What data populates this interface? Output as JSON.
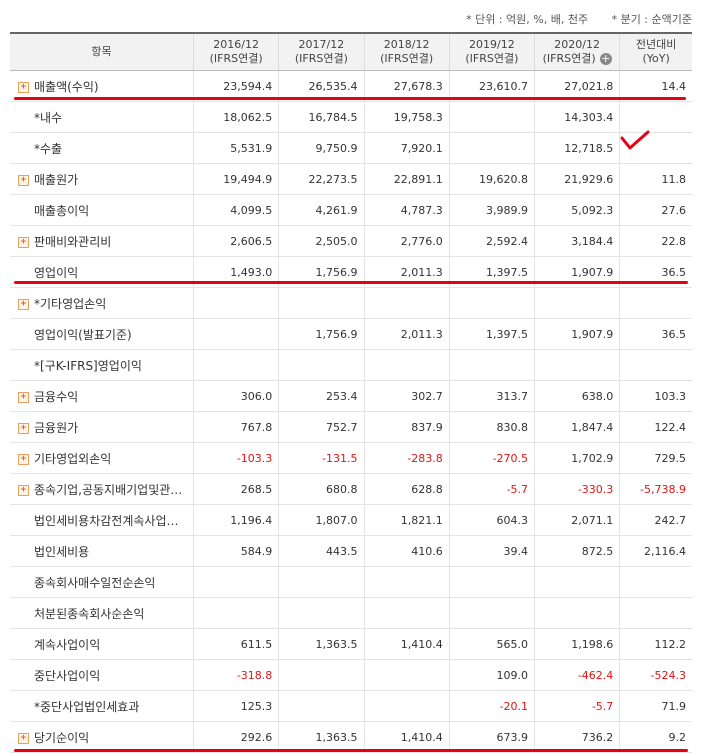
{
  "notes": {
    "unit": "* 단위 : 억원, %, 배, 천주",
    "basis": "* 분기 : 순액기준"
  },
  "columns": [
    "항목",
    "2016/12\n(IFRS연결)",
    "2017/12\n(IFRS연결)",
    "2018/12\n(IFRS연결)",
    "2019/12\n(IFRS연결)",
    "2020/12\n(IFRS연결)",
    "전년대비\n(YoY)"
  ],
  "rows": [
    {
      "label": "매출액(수익)",
      "expand": true,
      "indent": false,
      "values": [
        "23,594.4",
        "26,535.4",
        "27,678.3",
        "23,610.7",
        "27,021.8",
        "14.4"
      ],
      "neg": []
    },
    {
      "label": "*내수",
      "expand": false,
      "indent": true,
      "values": [
        "18,062.5",
        "16,784.5",
        "19,758.3",
        "",
        "14,303.4",
        ""
      ],
      "neg": []
    },
    {
      "label": "*수출",
      "expand": false,
      "indent": true,
      "values": [
        "5,531.9",
        "9,750.9",
        "7,920.1",
        "",
        "12,718.5",
        ""
      ],
      "neg": []
    },
    {
      "label": "매출원가",
      "expand": true,
      "indent": false,
      "values": [
        "19,494.9",
        "22,273.5",
        "22,891.1",
        "19,620.8",
        "21,929.6",
        "11.8"
      ],
      "neg": []
    },
    {
      "label": "매출총이익",
      "expand": false,
      "indent": true,
      "values": [
        "4,099.5",
        "4,261.9",
        "4,787.3",
        "3,989.9",
        "5,092.3",
        "27.6"
      ],
      "neg": []
    },
    {
      "label": "판매비와관리비",
      "expand": true,
      "indent": false,
      "values": [
        "2,606.5",
        "2,505.0",
        "2,776.0",
        "2,592.4",
        "3,184.4",
        "22.8"
      ],
      "neg": []
    },
    {
      "label": "영업이익",
      "expand": false,
      "indent": true,
      "values": [
        "1,493.0",
        "1,756.9",
        "2,011.3",
        "1,397.5",
        "1,907.9",
        "36.5"
      ],
      "neg": []
    },
    {
      "label": "*기타영업손익",
      "expand": true,
      "indent": false,
      "values": [
        "",
        "",
        "",
        "",
        "",
        ""
      ],
      "neg": []
    },
    {
      "label": "영업이익(발표기준)",
      "expand": false,
      "indent": true,
      "values": [
        "",
        "1,756.9",
        "2,011.3",
        "1,397.5",
        "1,907.9",
        "36.5"
      ],
      "neg": []
    },
    {
      "label": "*[구K-IFRS]영업이익",
      "expand": false,
      "indent": true,
      "values": [
        "",
        "",
        "",
        "",
        "",
        ""
      ],
      "neg": []
    },
    {
      "label": "금융수익",
      "expand": true,
      "indent": false,
      "values": [
        "306.0",
        "253.4",
        "302.7",
        "313.7",
        "638.0",
        "103.3"
      ],
      "neg": []
    },
    {
      "label": "금융원가",
      "expand": true,
      "indent": false,
      "values": [
        "767.8",
        "752.7",
        "837.9",
        "830.8",
        "1,847.4",
        "122.4"
      ],
      "neg": []
    },
    {
      "label": "기타영업외손익",
      "expand": true,
      "indent": false,
      "values": [
        "-103.3",
        "-131.5",
        "-283.8",
        "-270.5",
        "1,702.9",
        "729.5"
      ],
      "neg": [
        0,
        1,
        2,
        3
      ]
    },
    {
      "label": "종속기업,공동지배기업및관…",
      "expand": true,
      "indent": false,
      "values": [
        "268.5",
        "680.8",
        "628.8",
        "-5.7",
        "-330.3",
        "-5,738.9"
      ],
      "neg": [
        3,
        4,
        5
      ]
    },
    {
      "label": "법인세비용차감전계속사업…",
      "expand": false,
      "indent": true,
      "values": [
        "1,196.4",
        "1,807.0",
        "1,821.1",
        "604.3",
        "2,071.1",
        "242.7"
      ],
      "neg": []
    },
    {
      "label": "법인세비용",
      "expand": false,
      "indent": true,
      "values": [
        "584.9",
        "443.5",
        "410.6",
        "39.4",
        "872.5",
        "2,116.4"
      ],
      "neg": []
    },
    {
      "label": "종속회사매수일전순손익",
      "expand": false,
      "indent": true,
      "values": [
        "",
        "",
        "",
        "",
        "",
        ""
      ],
      "neg": []
    },
    {
      "label": "처분된종속회사순손익",
      "expand": false,
      "indent": true,
      "values": [
        "",
        "",
        "",
        "",
        "",
        ""
      ],
      "neg": []
    },
    {
      "label": "계속사업이익",
      "expand": false,
      "indent": true,
      "values": [
        "611.5",
        "1,363.5",
        "1,410.4",
        "565.0",
        "1,198.6",
        "112.2"
      ],
      "neg": []
    },
    {
      "label": "중단사업이익",
      "expand": false,
      "indent": true,
      "values": [
        "-318.8",
        "",
        "",
        "109.0",
        "-462.4",
        "-524.3"
      ],
      "neg": [
        0,
        4,
        5
      ]
    },
    {
      "label": "*중단사업법인세효과",
      "expand": false,
      "indent": true,
      "values": [
        "125.3",
        "",
        "",
        "-20.1",
        "-5.7",
        "71.9"
      ],
      "neg": [
        3,
        4
      ]
    },
    {
      "label": "당기순이익",
      "expand": true,
      "indent": false,
      "values": [
        "292.6",
        "1,363.5",
        "1,410.4",
        "673.9",
        "736.2",
        "9.2"
      ],
      "neg": []
    }
  ],
  "accent": "#e60012"
}
